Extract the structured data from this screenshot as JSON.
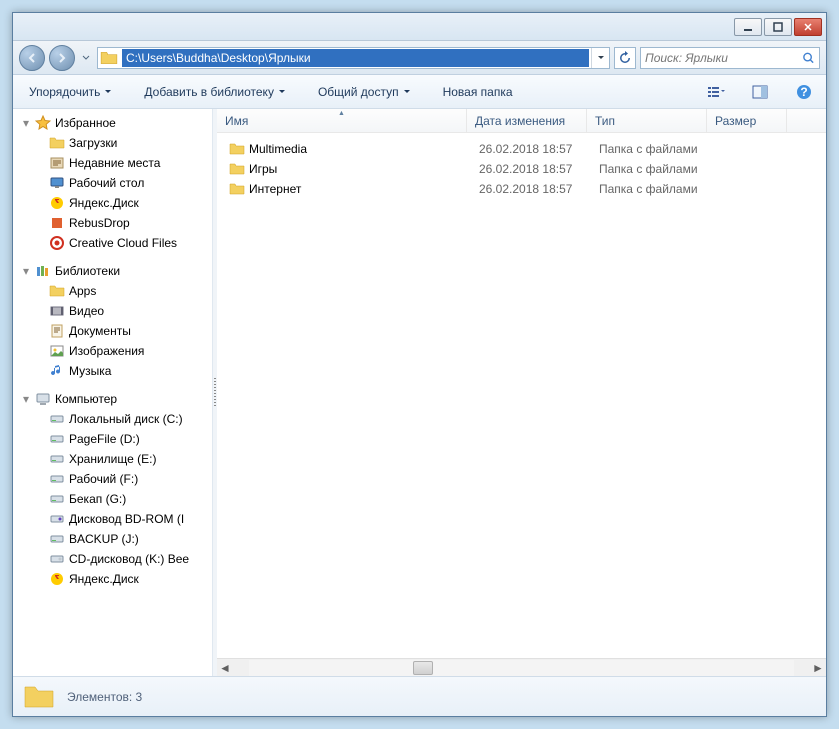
{
  "titlebar": {},
  "nav": {
    "address": "C:\\Users\\Buddha\\Desktop\\Ярлыки",
    "search_placeholder": "Поиск: Ярлыки"
  },
  "toolbar": {
    "organize": "Упорядочить",
    "addlib": "Добавить в библиотеку",
    "share": "Общий доступ",
    "newfolder": "Новая папка"
  },
  "sidebar": {
    "favorites": {
      "label": "Избранное",
      "items": [
        {
          "label": "Загрузки",
          "icon": "folder"
        },
        {
          "label": "Недавние места",
          "icon": "recent"
        },
        {
          "label": "Рабочий стол",
          "icon": "desktop"
        },
        {
          "label": "Яндекс.Диск",
          "icon": "yadisk"
        },
        {
          "label": "RebusDrop",
          "icon": "rebus"
        },
        {
          "label": "Creative Cloud Files",
          "icon": "cc"
        }
      ]
    },
    "libraries": {
      "label": "Библиотеки",
      "items": [
        {
          "label": "Apps",
          "icon": "folder"
        },
        {
          "label": "Видео",
          "icon": "video"
        },
        {
          "label": "Документы",
          "icon": "doc"
        },
        {
          "label": "Изображения",
          "icon": "image"
        },
        {
          "label": "Музыка",
          "icon": "music"
        }
      ]
    },
    "computer": {
      "label": "Компьютер",
      "items": [
        {
          "label": "Локальный диск (C:)",
          "icon": "disk"
        },
        {
          "label": "PageFile (D:)",
          "icon": "disk"
        },
        {
          "label": "Хранилище (E:)",
          "icon": "disk"
        },
        {
          "label": "Рабочий (F:)",
          "icon": "disk"
        },
        {
          "label": "Бекап (G:)",
          "icon": "disk"
        },
        {
          "label": "Дисковод BD-ROM (I",
          "icon": "bdrom"
        },
        {
          "label": "BACKUP (J:)",
          "icon": "disk"
        },
        {
          "label": "CD-дисковод (K:) Bee",
          "icon": "cdrom"
        },
        {
          "label": "Яндекс.Диск",
          "icon": "yadisk"
        }
      ]
    }
  },
  "columns": {
    "name": "Имя",
    "date": "Дата изменения",
    "type": "Тип",
    "size": "Размер"
  },
  "files": [
    {
      "name": "Multimedia",
      "date": "26.02.2018 18:57",
      "type": "Папка с файлами",
      "size": ""
    },
    {
      "name": "Игры",
      "date": "26.02.2018 18:57",
      "type": "Папка с файлами",
      "size": ""
    },
    {
      "name": "Интернет",
      "date": "26.02.2018 18:57",
      "type": "Папка с файлами",
      "size": ""
    }
  ],
  "status": {
    "text": "Элементов: 3"
  }
}
